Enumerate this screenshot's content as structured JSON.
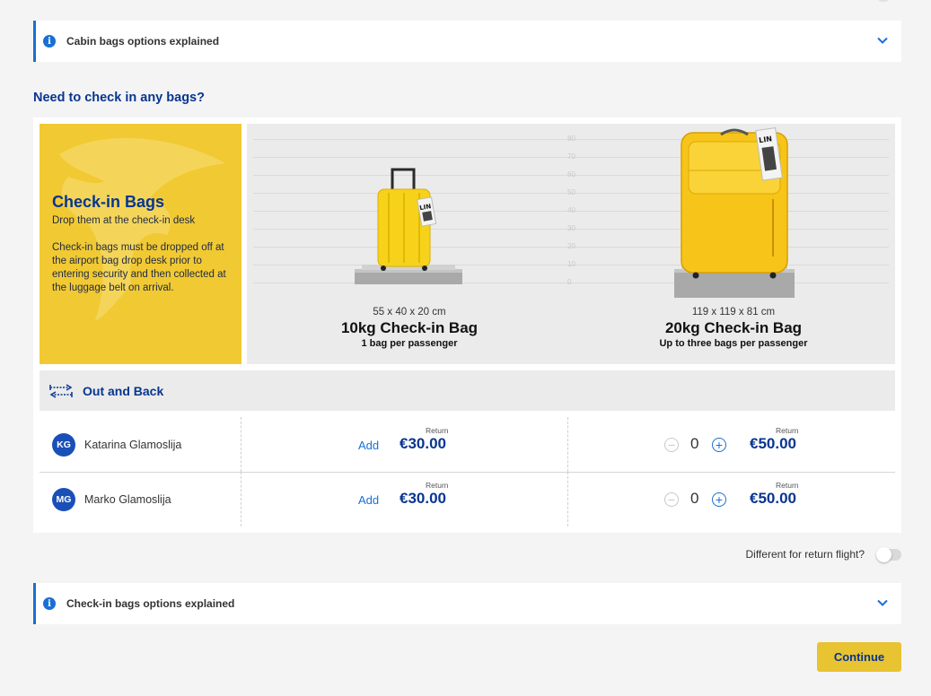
{
  "cabin_accordion": {
    "label": "Cabin bags options explained"
  },
  "section_title": "Need to check in any bags?",
  "promo": {
    "title": "Check-in Bags",
    "subtitle": "Drop them at the check-in desk",
    "description": "Check-in bags must be dropped off at the airport bag drop desk prior to entering security and then collected at the luggage belt on arrival."
  },
  "scale_ticks": [
    "80",
    "70",
    "60",
    "50",
    "40",
    "30",
    "20",
    "10",
    "0"
  ],
  "bags": [
    {
      "dims": "55 x 40 x 20 cm",
      "name": "10kg Check-in Bag",
      "limit": "1 bag per passenger",
      "tag": "LIN"
    },
    {
      "dims": "119 x 119 x 81 cm",
      "name": "20kg Check-in Bag",
      "limit": "Up to three bags per passenger",
      "tag": "LIN"
    }
  ],
  "route": {
    "label": "Out and Back"
  },
  "passengers": [
    {
      "initials": "KG",
      "name": "Katarina Glamoslija",
      "add_label": "Add",
      "small_return": "Return",
      "small_price": "€30.00",
      "qty": "0",
      "large_return": "Return",
      "large_price": "€50.00",
      "minus": "−",
      "plus": "+"
    },
    {
      "initials": "MG",
      "name": "Marko Glamoslija",
      "add_label": "Add",
      "small_return": "Return",
      "small_price": "€30.00",
      "qty": "0",
      "large_return": "Return",
      "large_price": "€50.00",
      "minus": "−",
      "plus": "+"
    }
  ],
  "return_toggle": {
    "label": "Different for return flight?",
    "on": false
  },
  "checkin_accordion": {
    "label": "Check-in bags options explained"
  },
  "continue_label": "Continue",
  "colors": {
    "brand_blue": "#073590",
    "accent_blue": "#1a6fd3",
    "brand_yellow": "#f1c933",
    "button_yellow": "#e8c332"
  }
}
